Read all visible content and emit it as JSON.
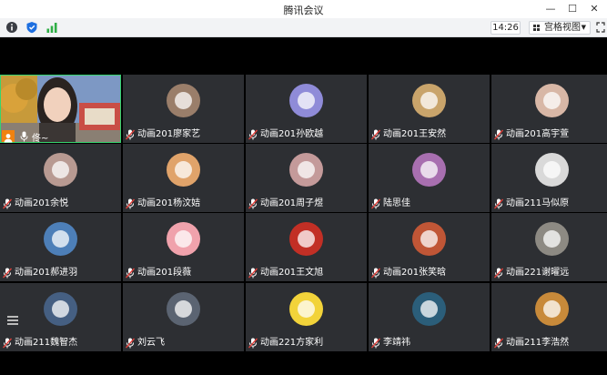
{
  "window": {
    "title": "腾讯会议",
    "minimize": "—",
    "maximize": "☐",
    "close": "✕"
  },
  "toolbar": {
    "clock": "14:26",
    "view_label": "宫格视图",
    "view_caret": "▼"
  },
  "host": {
    "name": "佟~",
    "mic_icon": "mic-icon"
  },
  "participants": [
    {
      "name": "动画201廖家艺",
      "color": "#9a7e6a"
    },
    {
      "name": "动画201孙欧越",
      "color": "#8f8bd8"
    },
    {
      "name": "动画201王安然",
      "color": "#c9a46b"
    },
    {
      "name": "动画201高宇萱",
      "color": "#d8b7a6"
    },
    {
      "name": "动画201余悦",
      "color": "#b89a92"
    },
    {
      "name": "动画201杨汶姞",
      "color": "#e0a36a"
    },
    {
      "name": "动画201周子煜",
      "color": "#c49a9a"
    },
    {
      "name": "陆思佳",
      "color": "#a86fb0"
    },
    {
      "name": "动画211马似原",
      "color": "#d9d9d9"
    },
    {
      "name": "动画201郝进羽",
      "color": "#4d7fb8"
    },
    {
      "name": "动画201段薇",
      "color": "#f0a2ac"
    },
    {
      "name": "动画201王文旭",
      "color": "#c22f25"
    },
    {
      "name": "动画201张笑晗",
      "color": "#c05636"
    },
    {
      "name": "动画221谢曜远",
      "color": "#8d8a83"
    },
    {
      "name": "动画211魏智杰",
      "color": "#455f82"
    },
    {
      "name": "刘云飞",
      "color": "#5b6472"
    },
    {
      "name": "动画221方家利",
      "color": "#f2d33a"
    },
    {
      "name": "李靖祎",
      "color": "#2b5e7a"
    },
    {
      "name": "动画211李浩然",
      "color": "#c88a3a"
    }
  ],
  "colors": {
    "tile_bg": "#2d2f33",
    "active_border": "#36d36f",
    "mic_red": "#e0403a",
    "host_badge": "#f0820f"
  }
}
